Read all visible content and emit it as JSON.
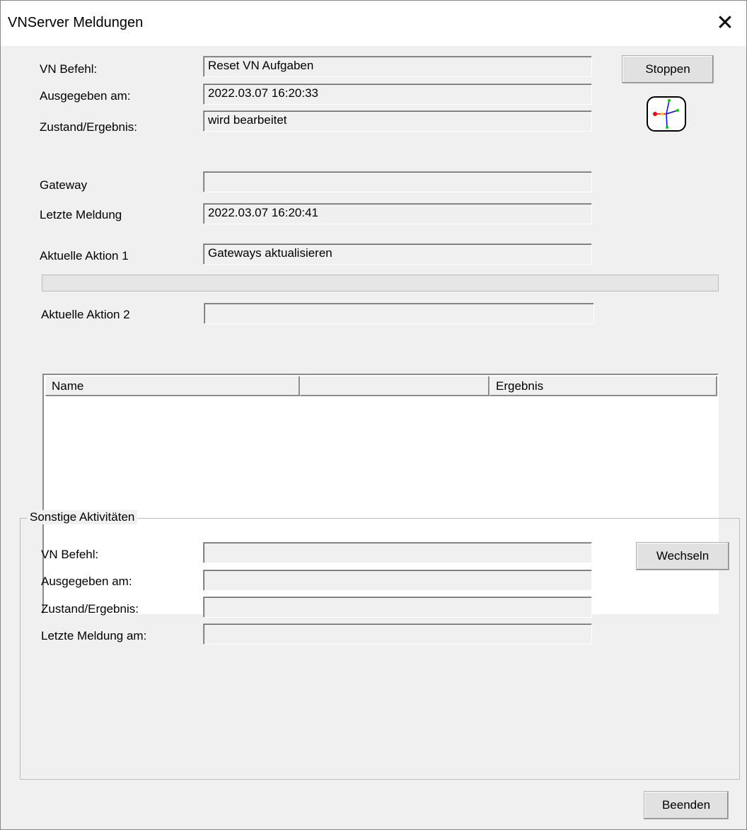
{
  "window": {
    "title": "VNServer Meldungen",
    "close_label": "✕"
  },
  "main": {
    "labels": {
      "vn_befehl": "VN Befehl:",
      "ausgegeben_am": "Ausgegeben am:",
      "zustand": "Zustand/Ergebnis:",
      "gateway": "Gateway",
      "letzte_meldung": "Letzte Meldung",
      "aktion1": "Aktuelle Aktion 1",
      "aktion2": "Aktuelle Aktion 2"
    },
    "values": {
      "vn_befehl": "Reset VN Aufgaben",
      "ausgegeben_am": "2022.03.07 16:20:33",
      "zustand": "wird bearbeitet",
      "gateway": "",
      "letzte_meldung": "2022.03.07 16:20:41",
      "aktion1": "Gateways aktualisieren",
      "aktion2": ""
    },
    "stop_button": "Stoppen",
    "progress": 0,
    "activity_icon": "activity-spinner-icon"
  },
  "table": {
    "columns": [
      "Name",
      "",
      "Ergebnis"
    ],
    "rows": []
  },
  "sonstige": {
    "title": "Sonstige Aktivitäten",
    "labels": {
      "vn_befehl": "VN Befehl:",
      "ausgegeben_am": "Ausgegeben am:",
      "zustand": "Zustand/Ergebnis:",
      "letzte_meldung": "Letzte Meldung am:"
    },
    "values": {
      "vn_befehl": "",
      "ausgegeben_am": "",
      "zustand": "",
      "letzte_meldung": ""
    },
    "switch_button": "Wechseln"
  },
  "footer": {
    "close_button": "Beenden"
  }
}
